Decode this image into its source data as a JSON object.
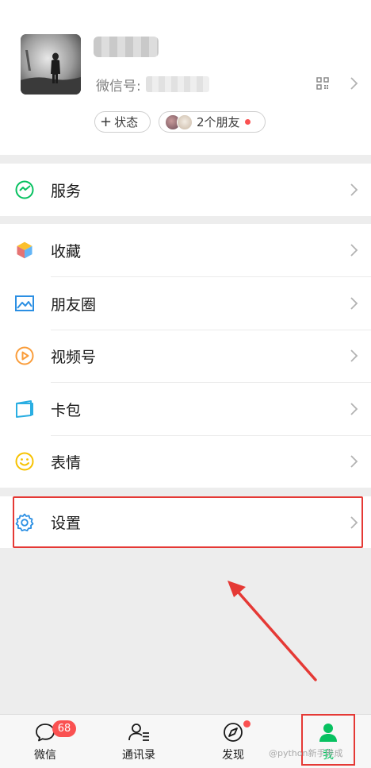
{
  "profile": {
    "wxid_label": "微信号:",
    "status_chip": "状态",
    "friends_chip": "2个朋友"
  },
  "menu": {
    "items": [
      {
        "label": "服务",
        "icon": "services-icon"
      },
      {
        "label": "收藏",
        "icon": "favorites-cube-icon"
      },
      {
        "label": "朋友圈",
        "icon": "moments-picture-icon"
      },
      {
        "label": "视频号",
        "icon": "channels-play-icon"
      },
      {
        "label": "卡包",
        "icon": "card-wallet-icon"
      },
      {
        "label": "表情",
        "icon": "sticker-smiley-icon"
      },
      {
        "label": "设置",
        "icon": "settings-gear-icon"
      }
    ]
  },
  "tabbar": {
    "tabs": [
      {
        "label": "微信",
        "icon": "chat-bubble-icon"
      },
      {
        "label": "通讯录",
        "icon": "contacts-icon"
      },
      {
        "label": "发现",
        "icon": "compass-icon"
      },
      {
        "label": "我",
        "icon": "person-icon"
      }
    ],
    "chats_badge": "68"
  },
  "watermark": "@python新手养成",
  "colors": {
    "accent_green": "#07c160",
    "badge_red": "#fa5151",
    "annotation_red": "#e53935",
    "background": "#ededed"
  }
}
